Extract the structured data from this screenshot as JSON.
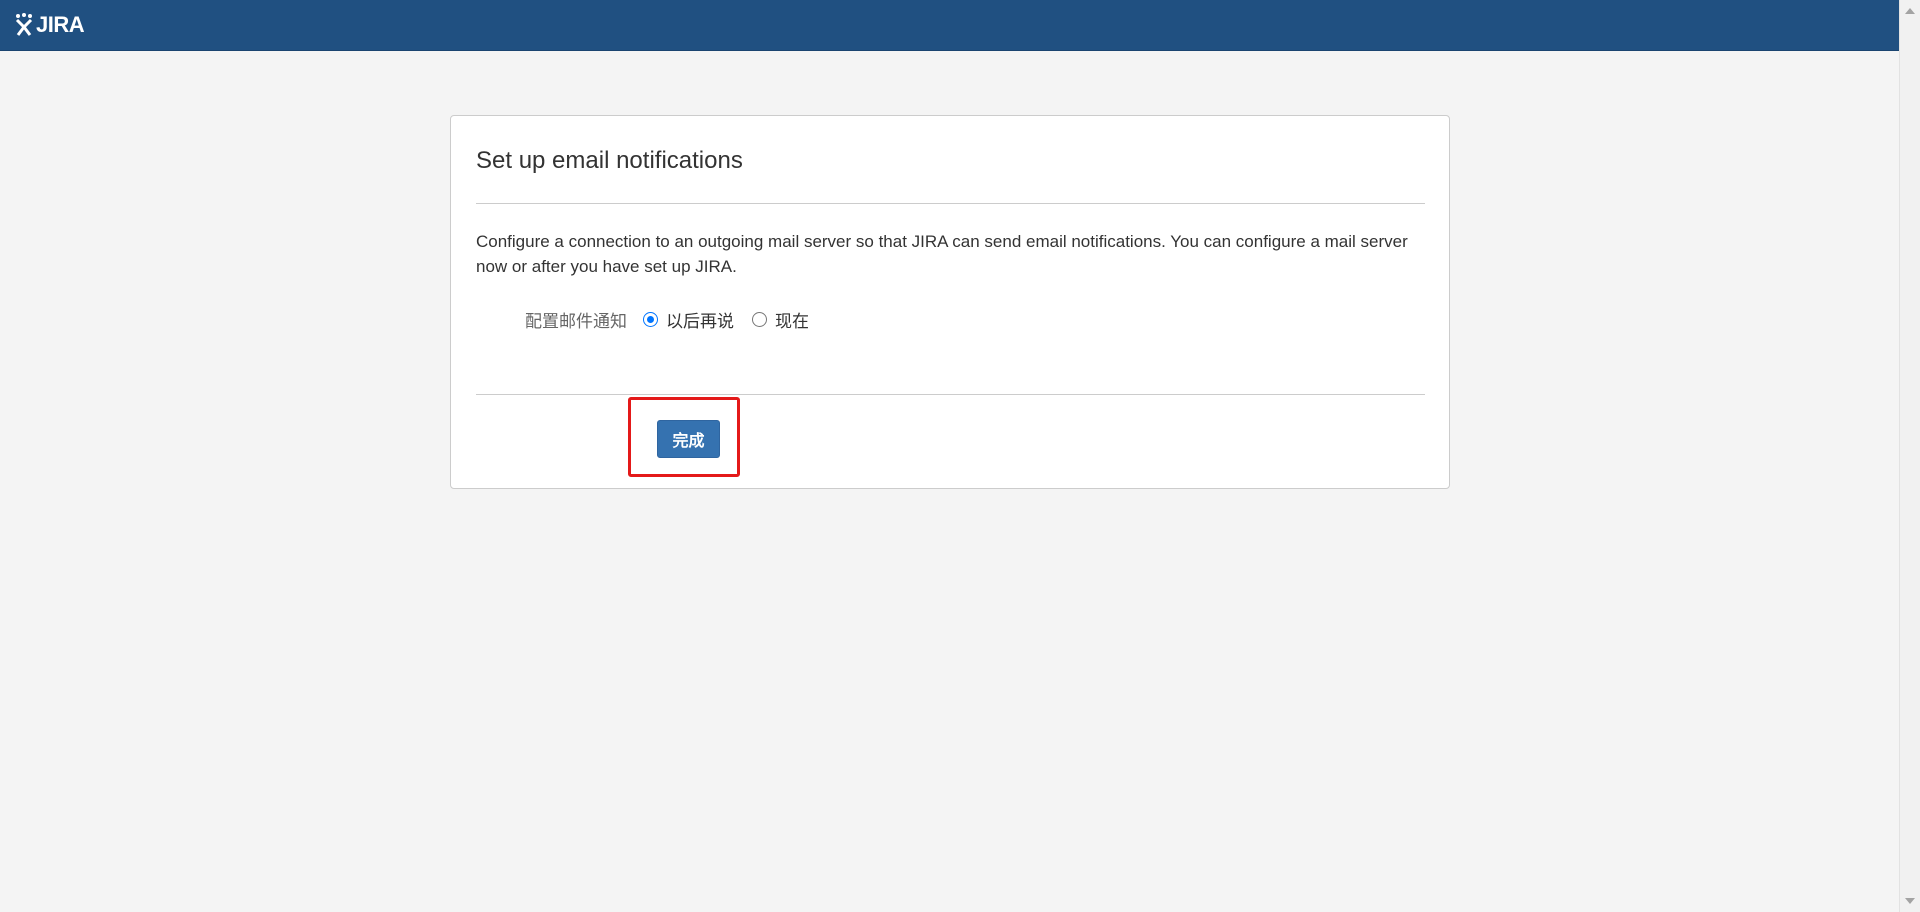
{
  "header": {
    "logo_text": "JIRA",
    "background_color": "#205081"
  },
  "panel": {
    "title": "Set up email notifications",
    "description": "Configure a connection to an outgoing mail server so that JIRA can send email notifications. You can configure a mail server now or after you have set up JIRA.",
    "field_label": "配置邮件通知",
    "options": [
      {
        "label": "以后再说",
        "selected": true
      },
      {
        "label": "现在",
        "selected": false
      }
    ],
    "done_label": "完成",
    "done_color": "#3572b0",
    "highlight_color": "#e41919"
  }
}
